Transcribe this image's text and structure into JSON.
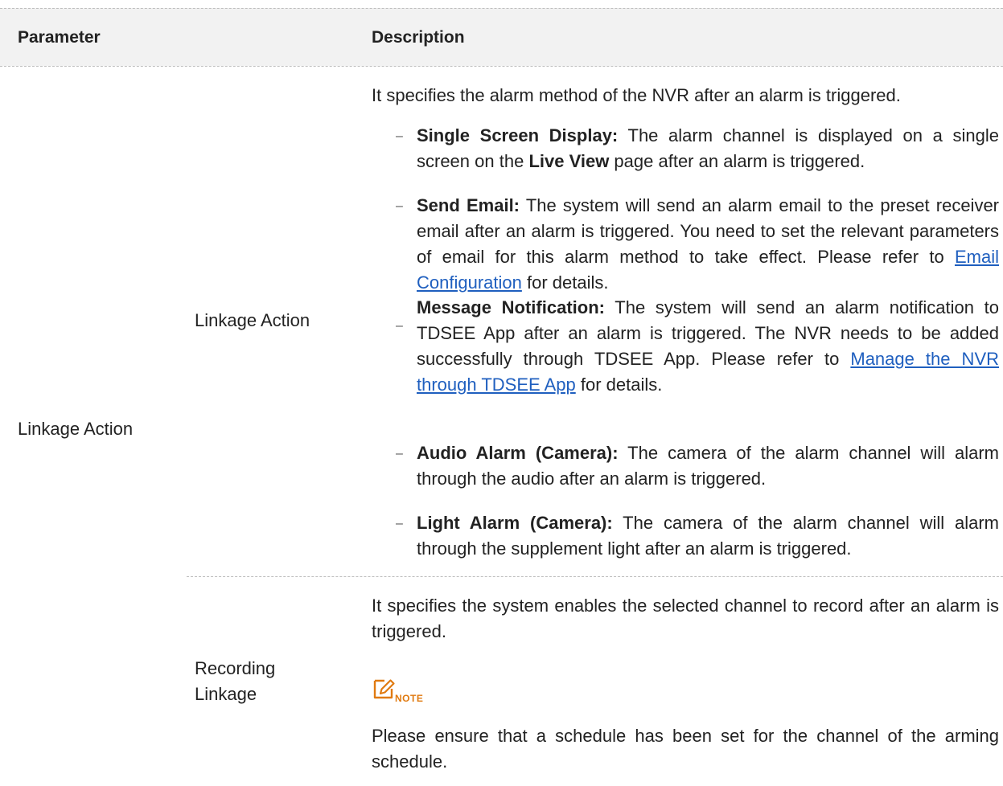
{
  "table": {
    "headers": {
      "parameter": "Parameter",
      "description": "Description"
    },
    "row_parameter": "Linkage Action",
    "sub1": {
      "label": "Linkage Action",
      "intro": "It specifies the alarm method of the NVR after an alarm is triggered.",
      "bullet_symbol": "–",
      "items": [
        {
          "title": "Single Screen Display:",
          "t1": " The alarm channel is displayed on a single screen on the ",
          "bold2": "Live View",
          "t2": " page after an alarm is triggered."
        },
        {
          "title": "Send Email:",
          "t1": " The system will send an alarm email to the preset receiver email after an alarm is triggered. You need to set the relevant parameters of email for this alarm method to take effect. Please refer to ",
          "link": "Email Configuration",
          "t2": " for details."
        },
        {
          "title": "Message Notification:",
          "t1": " The system will send an alarm notification to TDSEE App after an alarm is triggered. The NVR needs to be added successfully through TDSEE App. Please refer to ",
          "link": "Manage the NVR through TDSEE App",
          "t2": " for details."
        },
        {
          "title": "Audio Alarm (Camera):",
          "t1": " The camera of the alarm channel will alarm through the audio after an alarm is triggered."
        },
        {
          "title": "Light Alarm (Camera):",
          "t1": " The camera of the alarm channel will alarm through the supplement light after an alarm is triggered."
        }
      ]
    },
    "sub2": {
      "label": "Recording Linkage",
      "intro": "It specifies the system enables the selected channel to record after an alarm is triggered.",
      "note_label": "NOTE",
      "note_icon": "note-pencil-icon",
      "note_text": "Please ensure that a schedule has been set for the channel of the arming schedule."
    }
  },
  "colors": {
    "link": "#1f5fbf",
    "note": "#e07a10",
    "header_bg": "#f2f2f2",
    "rule": "#bfbfbf"
  }
}
